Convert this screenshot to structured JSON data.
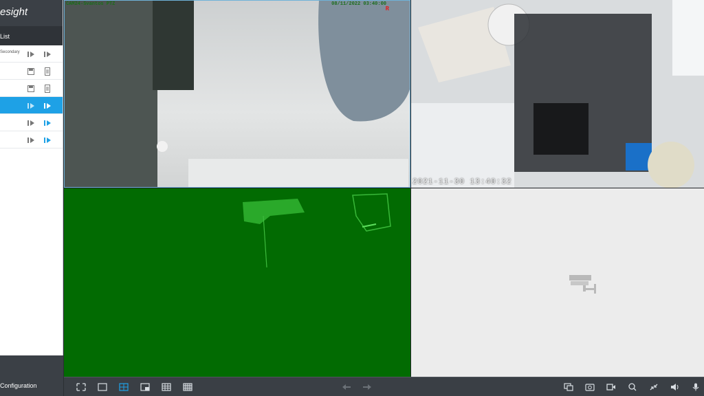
{
  "app": {
    "brand": "esight"
  },
  "sidebar": {
    "list_title": "List",
    "rows": [
      {
        "label": "Secondary",
        "selected": false,
        "icon_a": "record-icon",
        "icon_b": "play-icon"
      },
      {
        "label": "",
        "selected": false,
        "icon_a": "save-icon",
        "icon_b": "document-icon"
      },
      {
        "label": "",
        "selected": false,
        "icon_a": "save-icon",
        "icon_b": "document-icon"
      },
      {
        "label": "",
        "selected": true,
        "icon_a": "record-icon",
        "icon_b": "play-icon"
      },
      {
        "label": "",
        "selected": false,
        "icon_a": "record-icon",
        "icon_b": "play-icon"
      },
      {
        "label": "",
        "selected": false,
        "icon_a": "record-icon",
        "icon_b": "play-icon"
      }
    ],
    "config_label": "Configuration"
  },
  "video": {
    "tile1": {
      "camera_name": "CAM24-Svantos PTZ",
      "datetime": "08/11/2022 03:40:00",
      "rec_mark": "R"
    },
    "tile2": {
      "timestamp": "2021-11-30 13:40:32"
    },
    "tile4": {
      "placeholder_icon": "camera-icon"
    }
  },
  "toolbar": {
    "left": [
      "fullscreen-icon",
      "layout-1-icon",
      "layout-4-icon",
      "layout-6-icon",
      "layout-9-icon",
      "layout-16-icon"
    ],
    "active_layout": "layout-4-icon",
    "center": [
      "prev-arrow-icon",
      "next-arrow-icon"
    ],
    "right": [
      "switch-stream-icon",
      "snapshot-icon",
      "record-video-icon",
      "zoom-icon",
      "shrink-icon",
      "volume-icon",
      "microphone-icon"
    ]
  },
  "colors": {
    "accent": "#1ea1e6",
    "toolbar": "#3a3f45",
    "sidebar_dark": "#3b4046"
  }
}
